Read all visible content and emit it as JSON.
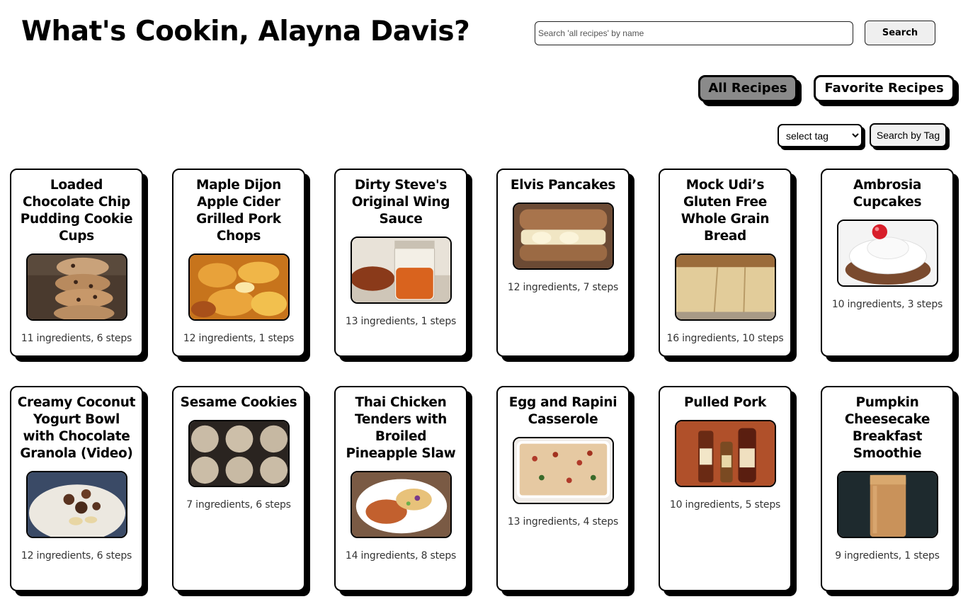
{
  "header": {
    "title": "What's Cookin, Alayna Davis?",
    "search_placeholder": "Search 'all recipes' by name",
    "search_button": "Search"
  },
  "view_toggle": {
    "all_label": "All Recipes",
    "favorites_label": "Favorite Recipes",
    "active": "All Recipes"
  },
  "tag_filter": {
    "selected": "select tag",
    "button_label": "Search by Tag"
  },
  "colors": {
    "active_toggle": "#8a8a8a",
    "border": "#000000",
    "background": "#ffffff"
  },
  "recipes": [
    {
      "name": "Loaded Chocolate Chip Pudding Cookie Cups",
      "meta": "11 ingredients, 6 steps",
      "image": "cookie-stack-photo"
    },
    {
      "name": "Maple Dijon Apple Cider Grilled Pork Chops",
      "meta": "12 ingredients, 1 steps",
      "image": "pork-chops-photo"
    },
    {
      "name": "Dirty Steve's Original Wing Sauce",
      "meta": "13 ingredients, 1 steps",
      "image": "wing-sauce-photo"
    },
    {
      "name": "Elvis Pancakes",
      "meta": "12 ingredients, 7 steps",
      "image": "pancake-sandwich-photo"
    },
    {
      "name": "Mock Udi’s Gluten Free Whole Grain Bread",
      "meta": "16 ingredients, 10 steps",
      "image": "bread-loaf-photo"
    },
    {
      "name": "Ambrosia Cupcakes",
      "meta": "10 ingredients, 3 steps",
      "image": "cupcake-photo"
    },
    {
      "name": "Creamy Coconut Yogurt Bowl with Chocolate Granola (Video)",
      "meta": "12 ingredients, 6 steps",
      "image": "yogurt-bowl-photo"
    },
    {
      "name": "Sesame Cookies",
      "meta": "7 ingredients, 6 steps",
      "image": "sesame-cookies-photo"
    },
    {
      "name": "Thai Chicken Tenders with Broiled Pineapple Slaw",
      "meta": "14 ingredients, 8 steps",
      "image": "chicken-slaw-photo"
    },
    {
      "name": "Egg and Rapini Casserole",
      "meta": "13 ingredients, 4 steps",
      "image": "casserole-photo"
    },
    {
      "name": "Pulled Pork",
      "meta": "10 ingredients, 5 steps",
      "image": "sauce-bottles-photo"
    },
    {
      "name": "Pumpkin Cheesecake Breakfast Smoothie",
      "meta": "9 ingredients, 1 steps",
      "image": "smoothie-photo"
    }
  ]
}
